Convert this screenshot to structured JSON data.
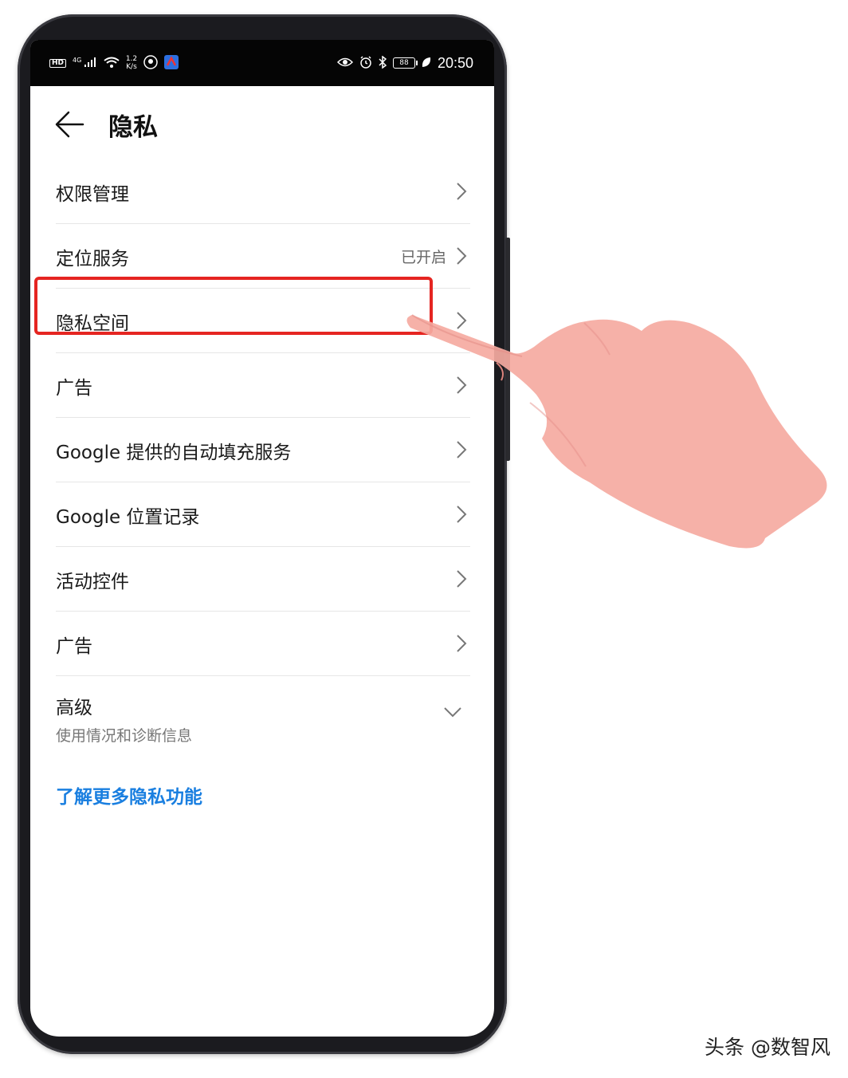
{
  "status_bar": {
    "hd": "HD",
    "network": "4G",
    "speed_top": "1.2",
    "speed_bottom": "K/s",
    "battery": "88",
    "time": "20:50"
  },
  "header": {
    "title": "隐私"
  },
  "list": {
    "items": [
      {
        "label": "权限管理"
      },
      {
        "label": "定位服务",
        "value": "已开启"
      },
      {
        "label": "隐私空间"
      },
      {
        "label": "广告"
      },
      {
        "label": "Google 提供的自动填充服务"
      },
      {
        "label": "Google 位置记录"
      },
      {
        "label": "活动控件"
      },
      {
        "label": "广告"
      }
    ],
    "advanced": {
      "label": "高级",
      "sublabel": "使用情况和诊断信息"
    }
  },
  "learn_more": "了解更多隐私功能",
  "watermark": "头条 @数智风",
  "colors": {
    "highlight": "#e52521",
    "link": "#1a7fe0",
    "status_bar": "#050505",
    "hand": "#f4a8a0"
  },
  "icons": [
    "back-arrow-icon",
    "chevron-right-icon",
    "chevron-down-icon",
    "eye-icon",
    "alarm-icon",
    "bluetooth-icon",
    "wifi-icon",
    "signal-icon",
    "battery-icon",
    "leaf-icon"
  ]
}
